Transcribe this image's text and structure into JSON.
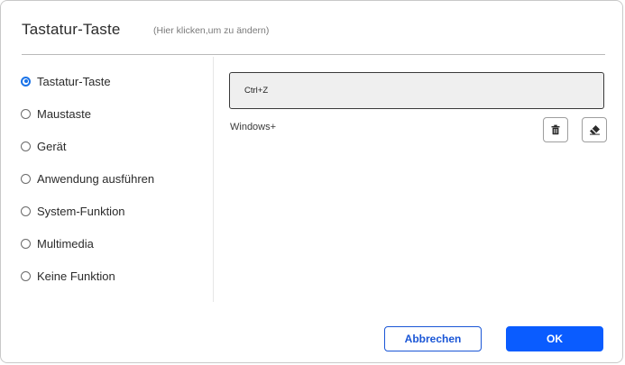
{
  "dialog": {
    "title": "Tastatur-Taste",
    "subtitle": "(Hier klicken,um zu ändern)"
  },
  "options": [
    {
      "label": "Tastatur-Taste",
      "selected": true
    },
    {
      "label": "Maustaste",
      "selected": false
    },
    {
      "label": "Gerät",
      "selected": false
    },
    {
      "label": "Anwendung ausführen",
      "selected": false
    },
    {
      "label": "System-Funktion",
      "selected": false
    },
    {
      "label": "Multimedia",
      "selected": false
    },
    {
      "label": "Keine Funktion",
      "selected": false
    }
  ],
  "key_field": {
    "value": "Ctrl+Z"
  },
  "windows_label": "Windows+",
  "icons": {
    "delete": "trash-icon",
    "clear": "eraser-icon"
  },
  "buttons": {
    "cancel_label": "Abbrechen",
    "ok_label": "OK"
  },
  "colors": {
    "accent": "#0a5cff",
    "radio_selected": "#1a73e8"
  }
}
